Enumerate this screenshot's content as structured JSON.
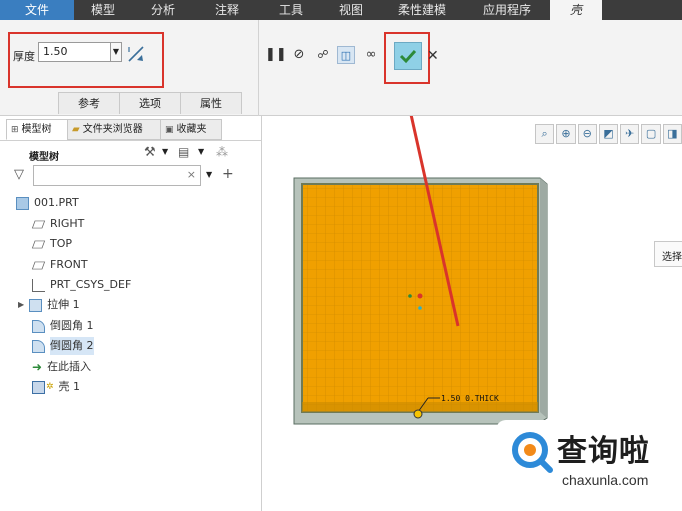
{
  "menu": [
    "文件",
    "模型",
    "分析",
    "注释",
    "工具",
    "视图",
    "柔性建模",
    "应用程序",
    "壳"
  ],
  "shell": {
    "thickness_label": "厚度",
    "thickness_value": "1.50",
    "tabs": [
      "参考",
      "选项",
      "属性"
    ]
  },
  "panel": {
    "tabs": [
      "模型树",
      "文件夹浏览器",
      "收藏夹"
    ],
    "tree_title": "模型树",
    "filter_placeholder": "",
    "items": [
      {
        "label": "001.PRT"
      },
      {
        "label": "RIGHT"
      },
      {
        "label": "TOP"
      },
      {
        "label": "FRONT"
      },
      {
        "label": "PRT_CSYS_DEF"
      },
      {
        "label": "拉伸 1"
      },
      {
        "label": "倒圆角 1"
      },
      {
        "label": "倒圆角 2"
      },
      {
        "label": "在此插入"
      },
      {
        "label": "壳 1"
      }
    ]
  },
  "graphics": {
    "dimension_label": "1.50 0.THICK",
    "tooltip": "选择",
    "part_color": "#f0a000"
  },
  "watermark": {
    "text": "查询啦",
    "url": "chaxunla.com"
  },
  "colors": {
    "accent": "#3a7ec0",
    "highlight_box": "#d9342b",
    "ok_check": "#2d8a39"
  }
}
